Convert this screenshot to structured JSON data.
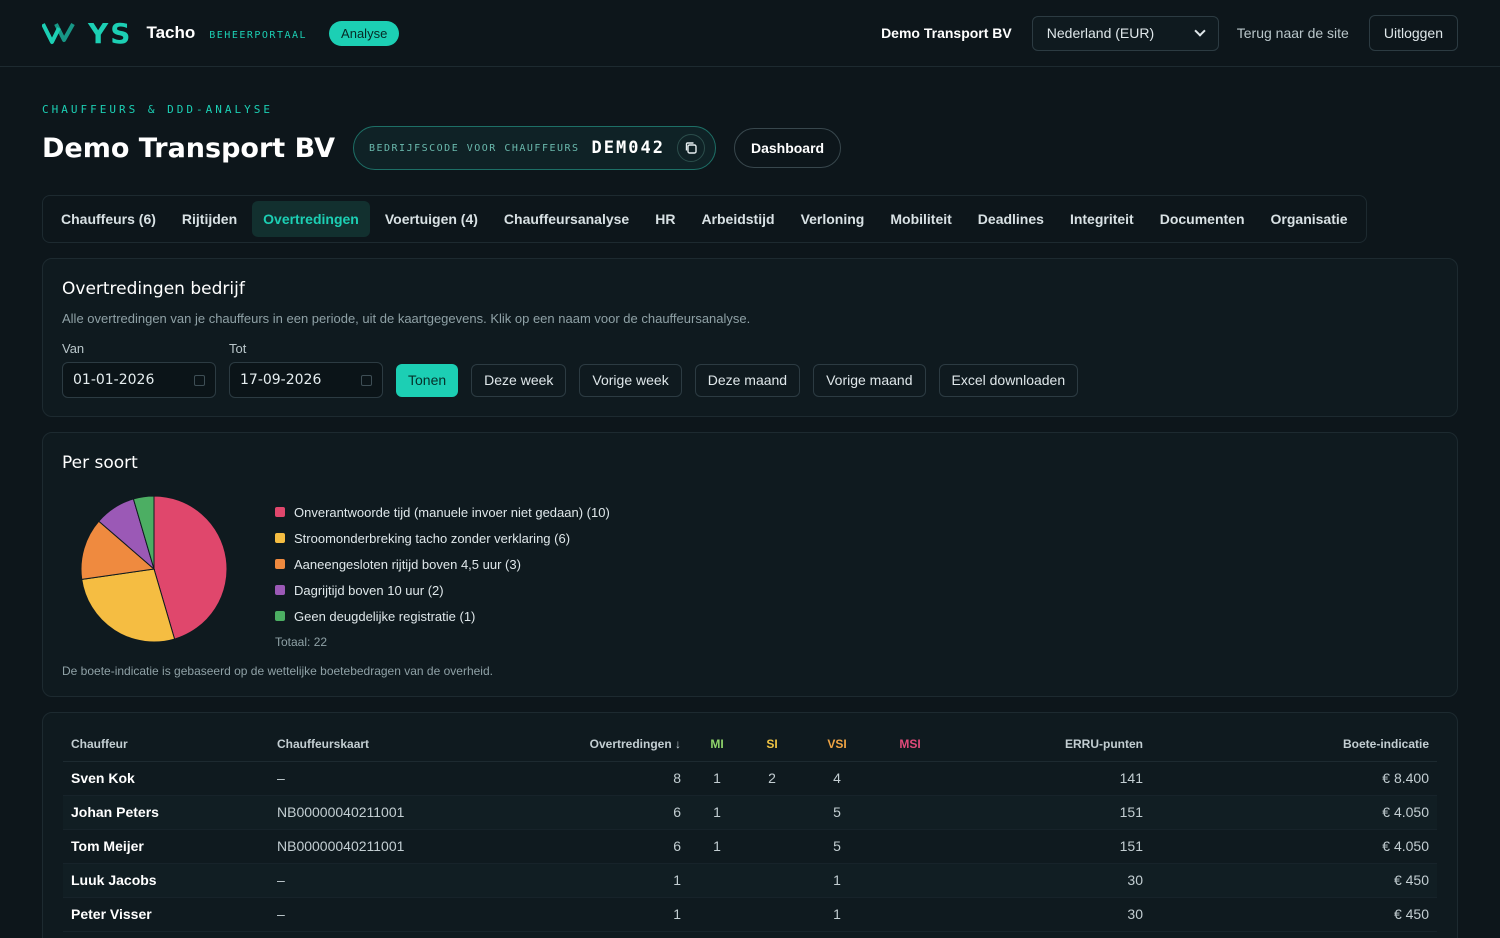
{
  "header": {
    "logo_text": "YS",
    "brand": "Tacho",
    "brand_sub": "BEHEERPORTAAL",
    "badge": "Analyse",
    "company": "Demo Transport BV",
    "country_select": "Nederland (EUR)",
    "back_link": "Terug naar de site",
    "logout": "Uitloggen"
  },
  "page": {
    "eyebrow": "CHAUFFEURS & DDD-ANALYSE",
    "title": "Demo Transport BV",
    "code_label": "BEDRIJFSCODE VOOR CHAUFFEURS",
    "code_value": "DEM042",
    "dashboard_button": "Dashboard"
  },
  "tabs": [
    {
      "label": "Chauffeurs (6)",
      "active": false
    },
    {
      "label": "Rijtijden",
      "active": false
    },
    {
      "label": "Overtredingen",
      "active": true
    },
    {
      "label": "Voertuigen (4)",
      "active": false
    },
    {
      "label": "Chauffeursanalyse",
      "active": false
    },
    {
      "label": "HR",
      "active": false
    },
    {
      "label": "Arbeidstijd",
      "active": false
    },
    {
      "label": "Verloning",
      "active": false
    },
    {
      "label": "Mobiliteit",
      "active": false
    },
    {
      "label": "Deadlines",
      "active": false
    },
    {
      "label": "Integriteit",
      "active": false
    },
    {
      "label": "Documenten",
      "active": false
    },
    {
      "label": "Organisatie",
      "active": false
    }
  ],
  "filter": {
    "title": "Overtredingen bedrijf",
    "description": "Alle overtredingen van je chauffeurs in een periode, uit de kaartgegevens. Klik op een naam voor de chauffeursanalyse.",
    "from_label": "Van",
    "to_label": "Tot",
    "from_value": "01-01-2026",
    "to_value": "17-09-2026",
    "show_button": "Tonen",
    "this_week": "Deze week",
    "last_week": "Vorige week",
    "this_month": "Deze maand",
    "last_month": "Vorige maand",
    "excel": "Excel downloaden"
  },
  "per_soort": {
    "title": "Per soort",
    "total_label": "Totaal: 22",
    "note": "De boete-indicatie is gebaseerd op de wettelijke boetebedragen van de overheid."
  },
  "chart_data": {
    "type": "pie",
    "categories": [
      "Onverantwoorde tijd (manuele invoer niet gedaan) (10)",
      "Stroomonderbreking tacho zonder verklaring (6)",
      "Aaneengesloten rijtijd boven 4,5 uur (3)",
      "Dagrijtijd boven 10 uur (2)",
      "Geen deugdelijke registratie (1)"
    ],
    "values": [
      10,
      6,
      3,
      2,
      1
    ],
    "colors": [
      "#e0476c",
      "#f5bd42",
      "#ef8a3f",
      "#9b59b6",
      "#4cae63"
    ],
    "title": "Per soort"
  },
  "table": {
    "columns": {
      "driver": "Chauffeur",
      "card": "Chauffeurskaart",
      "violations": "Overtredingen ↓",
      "mi": "MI",
      "si": "SI",
      "vsi": "VSI",
      "msi": "MSI",
      "erru": "ERRU-punten",
      "fine": "Boete-indicatie"
    },
    "rows": [
      {
        "driver": "Sven Kok",
        "card": "–",
        "violations": "8",
        "mi": "1",
        "si": "2",
        "vsi": "4",
        "msi": "",
        "erru": "141",
        "fine": "€ 8.400"
      },
      {
        "driver": "Johan Peters",
        "card": "NB00000040211001",
        "violations": "6",
        "mi": "1",
        "si": "",
        "vsi": "5",
        "msi": "",
        "erru": "151",
        "fine": "€ 4.050"
      },
      {
        "driver": "Tom Meijer",
        "card": "NB00000040211001",
        "violations": "6",
        "mi": "1",
        "si": "",
        "vsi": "5",
        "msi": "",
        "erru": "151",
        "fine": "€ 4.050"
      },
      {
        "driver": "Luuk Jacobs",
        "card": "–",
        "violations": "1",
        "mi": "",
        "si": "",
        "vsi": "1",
        "msi": "",
        "erru": "30",
        "fine": "€ 450"
      },
      {
        "driver": "Peter Visser",
        "card": "–",
        "violations": "1",
        "mi": "",
        "si": "",
        "vsi": "1",
        "msi": "",
        "erru": "30",
        "fine": "€ 450"
      }
    ]
  }
}
